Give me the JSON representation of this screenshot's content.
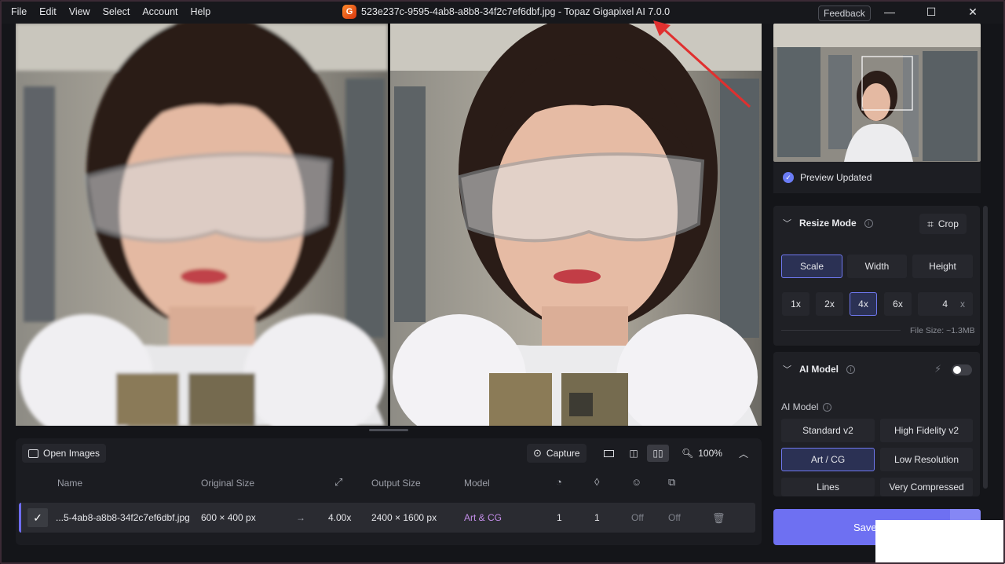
{
  "menu": [
    "File",
    "Edit",
    "View",
    "Select",
    "Account",
    "Help"
  ],
  "window": {
    "title": "523e237c-9595-4ab8-a8b8-34f2c7ef6dbf.jpg - Topaz Gigapixel AI 7.0.0",
    "logo_letter": "G",
    "feedback_label": "Feedback",
    "minimize": "—",
    "maximize": "☐",
    "close": "✕"
  },
  "toolbar": {
    "open_images": "Open Images",
    "capture": "Capture",
    "zoom": "100%"
  },
  "table": {
    "headers": {
      "name": "Name",
      "original_size": "Original Size",
      "output_size": "Output Size",
      "model": "Model"
    },
    "row": {
      "name": "...5-4ab8-a8b8-34f2c7ef6dbf.jpg",
      "original_size": "600 × 400 px",
      "scale": "4.00x",
      "output_size": "2400 × 1600 px",
      "model": "Art & CG",
      "c1": "1",
      "c2": "1",
      "c3": "Off",
      "c4": "Off"
    }
  },
  "preview_status": "Preview Updated",
  "resize": {
    "title": "Resize Mode",
    "crop_label": "Crop",
    "modes": [
      "Scale",
      "Width",
      "Height"
    ],
    "active_mode": "Scale",
    "scales": [
      "1x",
      "2x",
      "4x",
      "6x"
    ],
    "active_scale": "4x",
    "custom_value": "4",
    "custom_unit": "x",
    "file_size": "File Size: ~1.3MB"
  },
  "ai_model": {
    "title": "AI Model",
    "subtitle": "AI Model",
    "models": [
      "Standard v2",
      "High Fidelity v2",
      "Art / CG",
      "Low Resolution",
      "Lines",
      "Very Compressed"
    ],
    "active_model": "Art / CG"
  },
  "save_label": "Save",
  "colors": {
    "accent": "#6e70f2",
    "model_text": "#c38de8",
    "annotation_arrow": "#e0302f"
  }
}
